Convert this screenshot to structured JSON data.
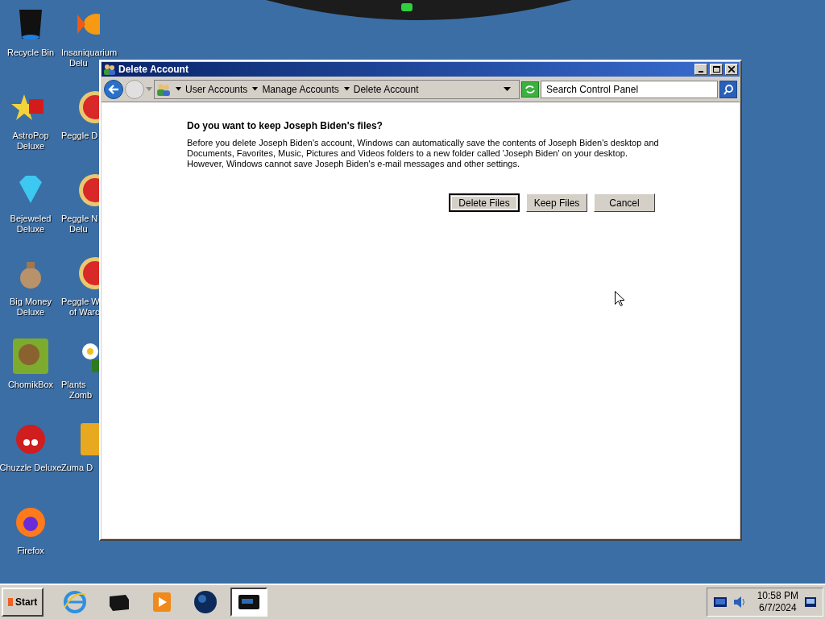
{
  "desktop": {
    "columns": [
      [
        {
          "kind": "bin",
          "lines": [
            "Recycle Bin"
          ]
        },
        {
          "kind": "star",
          "lines": [
            "AstroPop",
            "Deluxe"
          ]
        },
        {
          "kind": "gem",
          "lines": [
            "Bejeweled",
            "Deluxe"
          ]
        },
        {
          "kind": "bag",
          "lines": [
            "Big Money",
            "Deluxe"
          ]
        },
        {
          "kind": "animal",
          "lines": [
            "ChomikBox"
          ]
        },
        {
          "kind": "furball",
          "lines": [
            "Chuzzle Deluxe"
          ]
        },
        {
          "kind": "fox",
          "lines": [
            "Firefox"
          ]
        }
      ],
      [
        {
          "kind": "fish",
          "lines": [
            "Insaniquarium",
            "Delu"
          ]
        },
        {
          "kind": "peg",
          "lines": [
            "Peggle D"
          ]
        },
        {
          "kind": "peg",
          "lines": [
            "Peggle N",
            "Delu"
          ]
        },
        {
          "kind": "peg",
          "lines": [
            "Peggle W",
            "of Warc"
          ]
        },
        {
          "kind": "flower",
          "lines": [
            "Plants",
            "Zomb"
          ]
        },
        {
          "kind": "zuma",
          "lines": [
            "Zuma D"
          ]
        }
      ]
    ]
  },
  "window": {
    "title": "Delete Account",
    "breadcrumb": [
      "User Accounts",
      "Manage Accounts",
      "Delete Account"
    ],
    "search": {
      "placeholder": "Search Control Panel"
    },
    "heading": "Do you want to keep Joseph Biden's files?",
    "body": "Before you delete Joseph Biden's account, Windows can automatically save the contents of Joseph Biden's desktop and Documents, Favorites, Music, Pictures and Videos folders to a new folder called 'Joseph Biden' on your desktop. However, Windows cannot save Joseph Biden's e-mail messages and other settings.",
    "buttons": [
      {
        "label": "Delete Files",
        "default": true
      },
      {
        "label": "Keep Files",
        "default": false
      },
      {
        "label": "Cancel",
        "default": false
      }
    ]
  },
  "taskbar": {
    "start": "Start",
    "apps": [
      {
        "kind": "ie",
        "selected": false
      },
      {
        "kind": "box",
        "selected": false
      },
      {
        "kind": "media",
        "selected": false
      },
      {
        "kind": "globe",
        "selected": false
      },
      {
        "kind": "screen",
        "selected": true
      }
    ],
    "time": "10:58 PM",
    "date": "6/7/2024"
  }
}
